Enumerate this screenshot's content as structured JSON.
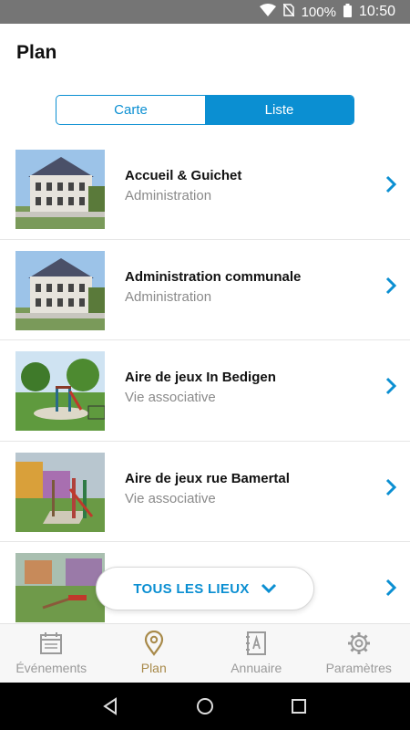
{
  "status_bar": {
    "battery": "100%",
    "time": "10:50"
  },
  "header": {
    "title": "Plan"
  },
  "segmented": {
    "tabs": [
      {
        "label": "Carte"
      },
      {
        "label": "Liste"
      }
    ]
  },
  "list": {
    "items": [
      {
        "title": "Accueil & Guichet",
        "subtitle": "Administration"
      },
      {
        "title": "Administration communale",
        "subtitle": "Administration"
      },
      {
        "title": "Aire de jeux In Bedigen",
        "subtitle": "Vie associative"
      },
      {
        "title": "Aire de jeux rue Bamertal",
        "subtitle": "Vie associative"
      },
      {
        "title": "",
        "subtitle": ""
      }
    ]
  },
  "fab": {
    "label": "TOUS LES LIEUX",
    "icon": "chevron-down-icon"
  },
  "bottom_nav": {
    "items": [
      {
        "label": "Événements",
        "icon": "calendar-icon"
      },
      {
        "label": "Plan",
        "icon": "map-pin-icon"
      },
      {
        "label": "Annuaire",
        "icon": "address-book-icon"
      },
      {
        "label": "Paramètres",
        "icon": "gear-icon"
      }
    ]
  },
  "colors": {
    "accent": "#0b8fd2",
    "active_nav": "#a88a4a",
    "inactive_nav": "#9a9a9a"
  }
}
